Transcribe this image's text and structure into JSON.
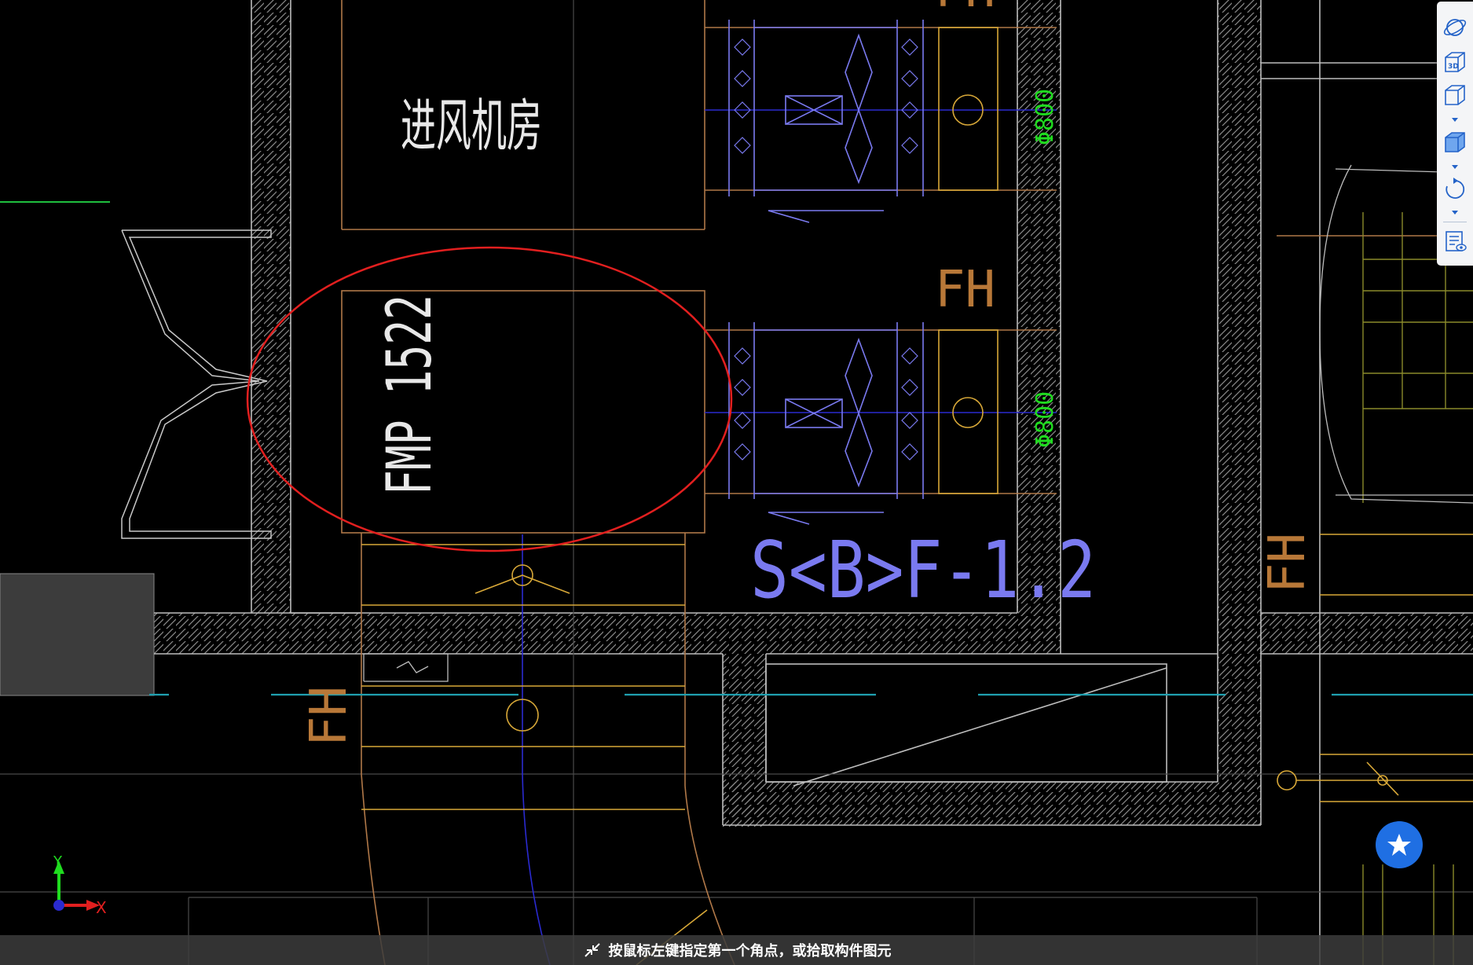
{
  "drawing": {
    "room_label": "进风机房",
    "door_label": "FMP 1522",
    "duct_label": "S<B>F-1.2",
    "fh_label_1": "FH",
    "fh_label_2": "FH",
    "fh_label_3": "FH",
    "fh_label_4": "FH",
    "dim_label_1": "Φ800",
    "dim_label_2": "Φ800"
  },
  "axes": {
    "x_label": "X",
    "y_label": "Y"
  },
  "toolbar": {
    "items": [
      "orbit-icon",
      "3d-view-icon",
      "cube-view-icon",
      "cube-solid-icon",
      "rotate-icon",
      "properties-icon"
    ]
  },
  "statusbar": {
    "prompt": "按鼠标左键指定第一个角点，或拾取构件图元"
  },
  "colors": {
    "background": "#000000",
    "wall": "#bdbdbd",
    "duct_orange": "#d8a838",
    "duct_brown": "#b07848",
    "equipment_blue": "#7a7af0",
    "dim_green": "#1fdc1f",
    "axis_cyan": "#1fa0b0",
    "selection_red": "#e21f1f",
    "fav_blue": "#1f6fe3"
  }
}
